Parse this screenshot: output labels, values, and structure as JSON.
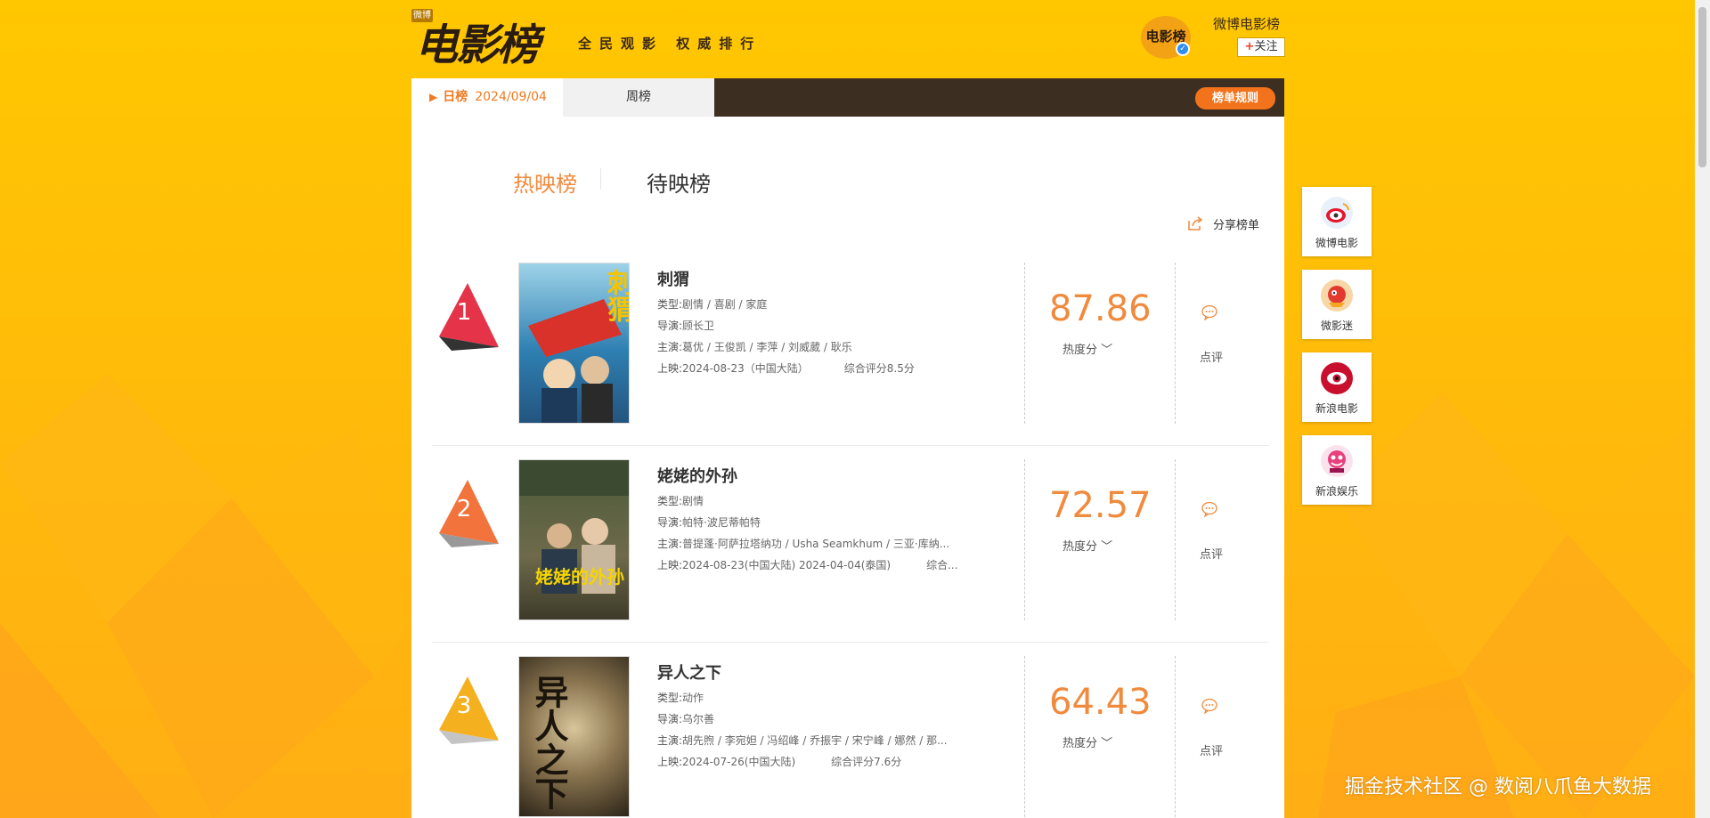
{
  "header": {
    "logo_tag": "微博",
    "logo_text": "电影榜",
    "slogan": "全民观影  权威排行",
    "account_avatar_text": "电影榜",
    "account_name": "微博电影榜",
    "follow_label": "关注",
    "follow_plus": "+"
  },
  "nav": {
    "daily_label": "日榜",
    "daily_date": "2024/09/04",
    "weekly_label": "周榜",
    "rules_label": "榜单规则"
  },
  "list_tabs": {
    "now_showing": "热映榜",
    "upcoming": "待映榜"
  },
  "share_label": "分享榜单",
  "movies": [
    {
      "rank": "1",
      "title": "刺猬",
      "genre_key": "类型:",
      "genre": "剧情 / 喜剧 / 家庭",
      "director_key": "导演:",
      "director": "顾长卫",
      "cast_key": "主演:",
      "cast": "葛优 / 王俊凯 / 李萍 / 刘威葳 / 耿乐",
      "release_key": "上映:",
      "release": "2024-08-23（中国大陆）",
      "score_note": "综合评分8.5分",
      "heat": "87.86",
      "heat_label": "热度分",
      "comment_label": "点评",
      "rank_color": "#e5344a",
      "poster_text": "刺猬"
    },
    {
      "rank": "2",
      "title": "姥姥的外孙",
      "genre_key": "类型:",
      "genre": "剧情",
      "director_key": "导演:",
      "director": "帕特·波尼蒂帕特",
      "cast_key": "主演:",
      "cast": "普提蓬·阿萨拉塔纳功 / Usha Seamkhum / 三亚·库纳...",
      "release_key": "上映:",
      "release": "2024-08-23(中国大陆) 2024-04-04(泰国)",
      "score_note": "综合...",
      "heat": "72.57",
      "heat_label": "热度分",
      "comment_label": "点评",
      "rank_color": "#f2733b",
      "poster_text": "姥姥的外孙"
    },
    {
      "rank": "3",
      "title": "异人之下",
      "genre_key": "类型:",
      "genre": "动作",
      "director_key": "导演:",
      "director": "乌尔善",
      "cast_key": "主演:",
      "cast": "胡先煦 / 李宛妲 / 冯绍峰 / 乔振宇 / 宋宁峰 / 娜然 / 那...",
      "release_key": "上映:",
      "release": "2024-07-26(中国大陆)",
      "score_note": "综合评分7.6分",
      "heat": "64.43",
      "heat_label": "热度分",
      "comment_label": "点评",
      "rank_color": "#f5b020",
      "poster_text": "异人之下"
    }
  ],
  "sidebar": [
    {
      "label": "微博电影",
      "icon": "weibo-movie-icon",
      "color": "#e8f1fa"
    },
    {
      "label": "微影迷",
      "icon": "weiyingmi-icon",
      "color": "#f7d7a8"
    },
    {
      "label": "新浪电影",
      "icon": "sina-movie-icon",
      "color": "#c8102e"
    },
    {
      "label": "新浪娱乐",
      "icon": "sina-ent-icon",
      "color": "#f4a9c6"
    }
  ],
  "watermark": "掘金技术社区 @ 数阅八爪鱼大数据",
  "colors": {
    "background": "#ffc300",
    "accent": "#f08a3d",
    "nav_dark": "#3d2e22",
    "rules_button": "#f2731b"
  }
}
